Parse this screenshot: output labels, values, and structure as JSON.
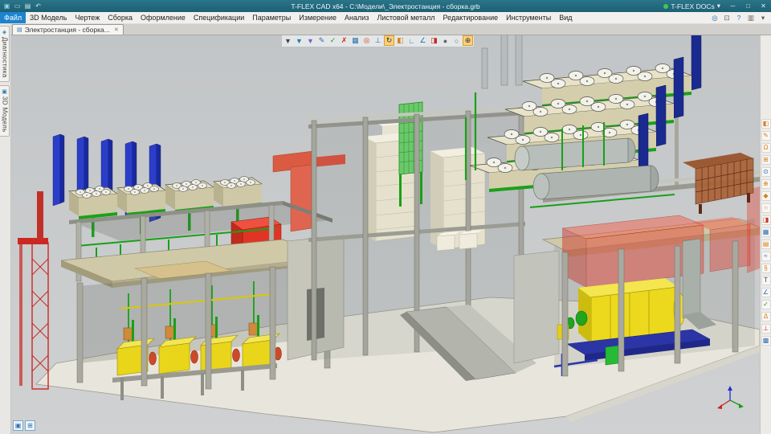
{
  "titlebar": {
    "title": "T-FLEX CAD x64 - C:\\Модели\\_Электростанция - сборка.grb",
    "quick_access": [
      {
        "name": "app-icon",
        "glyph": "▣",
        "color": "#8fd8f0"
      },
      {
        "name": "open-icon",
        "glyph": "▭",
        "color": "#cfe3ea"
      },
      {
        "name": "save-icon",
        "glyph": "▤",
        "color": "#cfe3ea"
      },
      {
        "name": "undo-icon",
        "glyph": "↶",
        "color": "#cfe3ea"
      }
    ],
    "docs": {
      "label": "T-FLEX DOCs",
      "chevron": "▾",
      "dot_color": "#44c64d"
    },
    "window_controls": [
      {
        "name": "minimize-button",
        "glyph": "─"
      },
      {
        "name": "maximize-button",
        "glyph": "□"
      },
      {
        "name": "close-button",
        "glyph": "✕"
      }
    ]
  },
  "menubar": {
    "items": [
      {
        "name": "menu-file",
        "label": "Файл",
        "active": true
      },
      {
        "name": "menu-3d-model",
        "label": "3D Модель"
      },
      {
        "name": "menu-drawing",
        "label": "Чертеж"
      },
      {
        "name": "menu-assembly",
        "label": "Сборка"
      },
      {
        "name": "menu-annotation",
        "label": "Оформление"
      },
      {
        "name": "menu-bom",
        "label": "Спецификации"
      },
      {
        "name": "menu-parameters",
        "label": "Параметры"
      },
      {
        "name": "menu-measure",
        "label": "Измерение"
      },
      {
        "name": "menu-analysis",
        "label": "Анализ"
      },
      {
        "name": "menu-sheet-metal",
        "label": "Листовой металл"
      },
      {
        "name": "menu-edit",
        "label": "Редактирование"
      },
      {
        "name": "menu-tools",
        "label": "Инструменты"
      },
      {
        "name": "menu-view",
        "label": "Вид"
      }
    ],
    "right_icons": [
      {
        "name": "command-search-icon",
        "glyph": "◎",
        "color": "#2a6fae"
      },
      {
        "name": "fullscreen-icon",
        "glyph": "⊡",
        "color": "#5a5a5a"
      },
      {
        "name": "help-icon",
        "glyph": "?",
        "color": "#2a6fae"
      },
      {
        "name": "panels-icon",
        "glyph": "▥",
        "color": "#5a5a5a"
      },
      {
        "name": "pin-icon",
        "glyph": "▾",
        "color": "#5a5a5a"
      }
    ]
  },
  "tabbar": {
    "tabs": [
      {
        "name": "tab-electrostation",
        "label": "Электростанция - сборка...",
        "icon_glyph": "▤",
        "close_glyph": "✕",
        "active": true
      }
    ]
  },
  "left_panel": {
    "tabs": [
      {
        "name": "tab-diagnostics",
        "label": "Диагностика",
        "icon": "◈"
      },
      {
        "name": "tab-3d-model",
        "label": "3D Модель",
        "icon": "▣"
      }
    ]
  },
  "viewport": {
    "toolbar": [
      {
        "name": "selection-filter-icon",
        "glyph": "▼",
        "color": "#444444"
      },
      {
        "name": "filter-solids-icon",
        "glyph": "▼",
        "color": "#1a7fae"
      },
      {
        "name": "filter-faces-icon",
        "glyph": "▼",
        "color": "#7a5cc6"
      },
      {
        "name": "filter-edit-icon",
        "glyph": "✎",
        "color": "#2a6fae"
      },
      {
        "name": "apply-icon",
        "glyph": "✓",
        "color": "#1a9c1a"
      },
      {
        "name": "cancel-icon",
        "glyph": "✗",
        "color": "#cc2222"
      },
      {
        "name": "grid-icon",
        "glyph": "▦",
        "color": "#2a6fae"
      },
      {
        "name": "snap-icon",
        "glyph": "◎",
        "color": "#cc4422"
      },
      {
        "name": "axes-icon",
        "glyph": "⊥",
        "color": "#2a6fae"
      },
      {
        "name": "rotate-view-icon",
        "glyph": "↻",
        "color": "#333333",
        "active": true
      },
      {
        "name": "workplane-icon",
        "glyph": "◧",
        "color": "#d87f1a"
      },
      {
        "name": "lcs-icon",
        "glyph": "∟",
        "color": "#2a6fae"
      },
      {
        "name": "dimension-icon",
        "glyph": "∠",
        "color": "#2a6fae"
      },
      {
        "name": "section-view-icon",
        "glyph": "◨",
        "color": "#cc2222"
      },
      {
        "name": "shaded-mode-icon",
        "glyph": "●",
        "color": "#666666"
      },
      {
        "name": "wireframe-mode-icon",
        "glyph": "○",
        "color": "#666666"
      },
      {
        "name": "zoom-all-icon",
        "glyph": "⊕",
        "color": "#333333",
        "active": true
      }
    ],
    "page_icons": [
      {
        "name": "page-3d-view-icon",
        "glyph": "▣"
      },
      {
        "name": "add-page-icon",
        "glyph": "⊞"
      }
    ]
  },
  "right_panel": {
    "icons": [
      {
        "name": "workplane-tool-icon",
        "glyph": "◧",
        "color": "#d87f1a"
      },
      {
        "name": "sketch-tool-icon",
        "glyph": "✎",
        "color": "#d87f1a"
      },
      {
        "name": "profile-tool-icon",
        "glyph": "Ω",
        "color": "#d87f1a"
      },
      {
        "name": "extrude-tool-icon",
        "glyph": "⊞",
        "color": "#d87f1a"
      },
      {
        "name": "revolve-tool-icon",
        "glyph": "⊙",
        "color": "#2a6fae"
      },
      {
        "name": "boolean-tool-icon",
        "glyph": "⊕",
        "color": "#d87f1a"
      },
      {
        "name": "blend-tool-icon",
        "glyph": "◆",
        "color": "#d87f1a"
      },
      {
        "name": "hole-tool-icon",
        "glyph": "○",
        "color": "#d87f1a"
      },
      {
        "name": "section-tool-icon",
        "glyph": "◨",
        "color": "#cc3322"
      },
      {
        "name": "array-tool-icon",
        "glyph": "▦",
        "color": "#2a6fae"
      },
      {
        "name": "fragment-tool-icon",
        "glyph": "▤",
        "color": "#d87f1a"
      },
      {
        "name": "pipe-tool-icon",
        "glyph": "≈",
        "color": "#2a6fae"
      },
      {
        "name": "spring-tool-icon",
        "glyph": "§",
        "color": "#d87f1a"
      },
      {
        "name": "text-tool-icon",
        "glyph": "T",
        "color": "#444444"
      },
      {
        "name": "measure-tool-icon",
        "glyph": "∠",
        "color": "#2a6fae"
      },
      {
        "name": "check-tool-icon",
        "glyph": "✓",
        "color": "#1a9c1a"
      },
      {
        "name": "weld-tool-icon",
        "glyph": "Δ",
        "color": "#d87f1a"
      },
      {
        "name": "lcs-tool-icon",
        "glyph": "⊥",
        "color": "#cc3322"
      },
      {
        "name": "mesh-tool-icon",
        "glyph": "▩",
        "color": "#2a6fae"
      }
    ]
  },
  "scene": {
    "description": "3D model of a power station assembly",
    "colors": {
      "structure": "#a8a89e",
      "slab": "#cfc9a7",
      "piping": "#18a018",
      "chimney": "#2b3ec9",
      "alarm": "#e23424",
      "machinery": "#e9d51a"
    }
  }
}
